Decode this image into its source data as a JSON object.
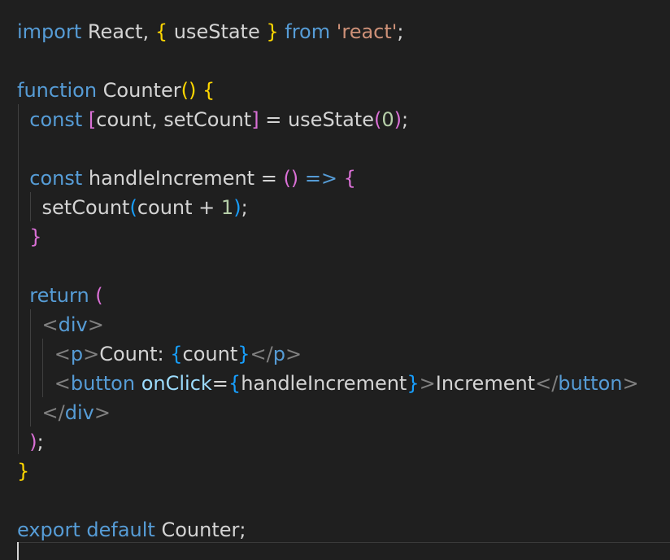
{
  "editor": {
    "language": "javascript-react",
    "colors": {
      "background": "#1f1f1f",
      "keyword": "#569cd6",
      "string": "#ce9178",
      "number": "#b5cea8",
      "text": "#d4d4d4",
      "attribute": "#9cdcfe",
      "bracket_level1": "#ffd700",
      "bracket_level2": "#da70d6",
      "bracket_level3": "#179fff"
    },
    "lines": [
      [
        [
          "kw",
          "import"
        ],
        [
          "txt",
          " React, "
        ],
        [
          "b1",
          "{"
        ],
        [
          "txt",
          " useState "
        ],
        [
          "b1",
          "}"
        ],
        [
          "kw",
          " from "
        ],
        [
          "str",
          "'react'"
        ],
        [
          "txt",
          ";"
        ]
      ],
      [],
      [
        [
          "kw",
          "function"
        ],
        [
          "txt",
          " Counter"
        ],
        [
          "b1",
          "()"
        ],
        [
          "txt",
          " "
        ],
        [
          "b1",
          "{"
        ]
      ],
      [
        [
          "txt",
          "  "
        ],
        [
          "kw",
          "const"
        ],
        [
          "txt",
          " "
        ],
        [
          "b2",
          "["
        ],
        [
          "txt",
          "count, setCount"
        ],
        [
          "b2",
          "]"
        ],
        [
          "txt",
          " = useState"
        ],
        [
          "b2",
          "("
        ],
        [
          "num",
          "0"
        ],
        [
          "b2",
          ")"
        ],
        [
          "txt",
          ";"
        ]
      ],
      [],
      [
        [
          "txt",
          "  "
        ],
        [
          "kw",
          "const"
        ],
        [
          "txt",
          " handleIncrement = "
        ],
        [
          "b2",
          "()"
        ],
        [
          "txt",
          " "
        ],
        [
          "kw",
          "=>"
        ],
        [
          "txt",
          " "
        ],
        [
          "b2",
          "{"
        ]
      ],
      [
        [
          "txt",
          "    setCount"
        ],
        [
          "b3",
          "("
        ],
        [
          "txt",
          "count + "
        ],
        [
          "num",
          "1"
        ],
        [
          "b3",
          ")"
        ],
        [
          "txt",
          ";"
        ]
      ],
      [
        [
          "txt",
          "  "
        ],
        [
          "b2",
          "}"
        ]
      ],
      [],
      [
        [
          "txt",
          "  "
        ],
        [
          "kw",
          "return"
        ],
        [
          "txt",
          " "
        ],
        [
          "b2",
          "("
        ]
      ],
      [
        [
          "txt",
          "    "
        ],
        [
          "ang",
          "<"
        ],
        [
          "tag",
          "div"
        ],
        [
          "ang",
          ">"
        ]
      ],
      [
        [
          "txt",
          "      "
        ],
        [
          "ang",
          "<"
        ],
        [
          "tag",
          "p"
        ],
        [
          "ang",
          ">"
        ],
        [
          "txt",
          "Count: "
        ],
        [
          "b3",
          "{"
        ],
        [
          "txt",
          "count"
        ],
        [
          "b3",
          "}"
        ],
        [
          "ang",
          "</"
        ],
        [
          "tag",
          "p"
        ],
        [
          "ang",
          ">"
        ]
      ],
      [
        [
          "txt",
          "      "
        ],
        [
          "ang",
          "<"
        ],
        [
          "tag",
          "button"
        ],
        [
          "txt",
          " "
        ],
        [
          "attr",
          "onClick"
        ],
        [
          "txt",
          "="
        ],
        [
          "b3",
          "{"
        ],
        [
          "txt",
          "handleIncrement"
        ],
        [
          "b3",
          "}"
        ],
        [
          "ang",
          ">"
        ],
        [
          "txt",
          "Increment"
        ],
        [
          "ang",
          "</"
        ],
        [
          "tag",
          "button"
        ],
        [
          "ang",
          ">"
        ]
      ],
      [
        [
          "txt",
          "    "
        ],
        [
          "ang",
          "</"
        ],
        [
          "tag",
          "div"
        ],
        [
          "ang",
          ">"
        ]
      ],
      [
        [
          "txt",
          "  "
        ],
        [
          "b2",
          ")"
        ],
        [
          "txt",
          ";"
        ]
      ],
      [
        [
          "b1",
          "}"
        ]
      ],
      [],
      [
        [
          "kw",
          "export"
        ],
        [
          "txt",
          " "
        ],
        [
          "kw",
          "default"
        ],
        [
          "txt",
          " Counter;"
        ]
      ]
    ]
  }
}
